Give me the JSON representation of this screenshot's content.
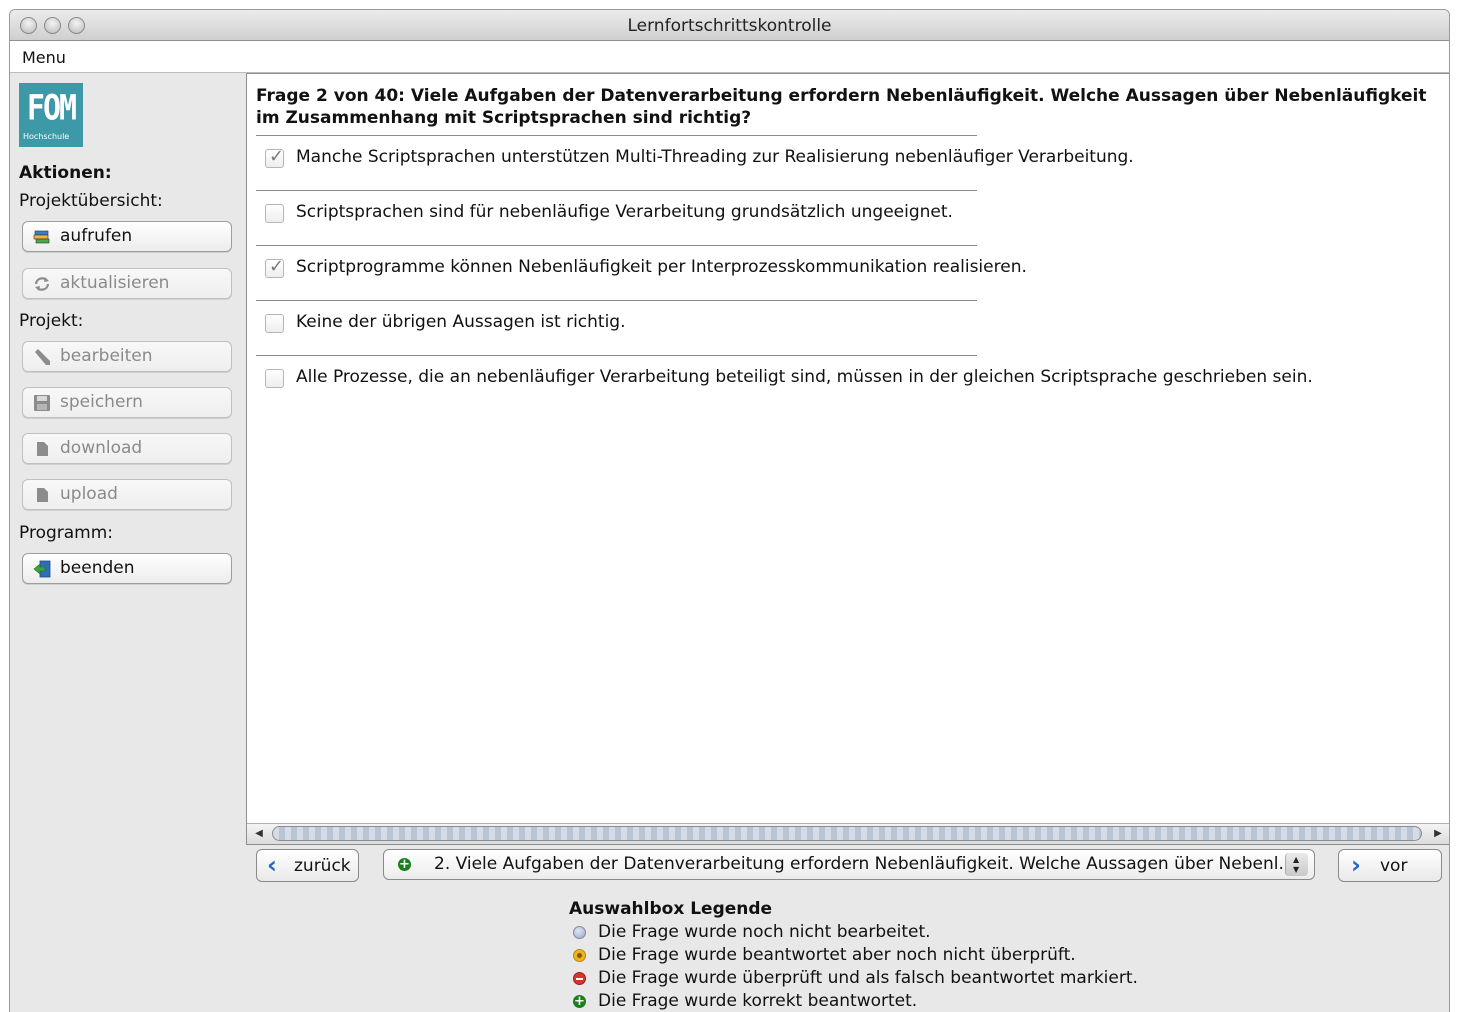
{
  "window": {
    "title": "Lernfortschrittskontrolle"
  },
  "menu": {
    "label": "Menu"
  },
  "sidebar": {
    "logo_text": "FOM",
    "logo_subtext": "Hochschule",
    "heading": "Aktionen:",
    "section_overview": "Projektübersicht:",
    "btn_aufrufen": "aufrufen",
    "btn_aktualisieren": "aktualisieren",
    "section_project": "Projekt:",
    "btn_bearbeiten": "bearbeiten",
    "btn_speichern": "speichern",
    "btn_download": "download",
    "btn_upload": "upload",
    "section_program": "Programm:",
    "btn_beenden": "beenden"
  },
  "question": {
    "text": "Frage 2 von 40: Viele Aufgaben der Datenverarbeitung erfordern Nebenläufigkeit. Welche Aussagen über Nebenläufigkeit im Zusammenhang mit Scriptsprachen sind richtig?",
    "answers": [
      {
        "text": "Manche Scriptsprachen unterstützen Multi-Threading zur Realisierung nebenläufiger Verarbeitung.",
        "checked": true
      },
      {
        "text": "Scriptsprachen sind für nebenläufige Verarbeitung grundsätzlich ungeeignet.",
        "checked": false
      },
      {
        "text": "Scriptprogramme können Nebenläufigkeit per Interprozesskommunikation realisieren.",
        "checked": true
      },
      {
        "text": "Keine der übrigen Aussagen ist richtig.",
        "checked": false
      },
      {
        "text": "Alle Prozesse, die an nebenläufiger Verarbeitung beteiligt sind, müssen in der gleichen Scriptsprache geschrieben sein.",
        "checked": false
      }
    ]
  },
  "nav": {
    "back_label": "zurück",
    "forward_label": "vor",
    "select_value": "2. Viele Aufgaben der Datenverarbeitung erfordern Nebenläufigkeit. Welche Aussagen über Nebenl..."
  },
  "legend": {
    "title": "Auswahlbox Legende",
    "items": [
      {
        "text": "Die Frage wurde noch nicht bearbeitet.",
        "color": "#9aa7c4"
      },
      {
        "text": "Die Frage wurde beantwortet aber noch nicht überprüft.",
        "color": "#f0b41c"
      },
      {
        "text": "Die Frage wurde überprüft und als falsch beantwortet markiert.",
        "color": "#d8342a"
      },
      {
        "text": "Die Frage wurde korrekt beantwortet.",
        "color": "#1b7f1b"
      }
    ]
  }
}
